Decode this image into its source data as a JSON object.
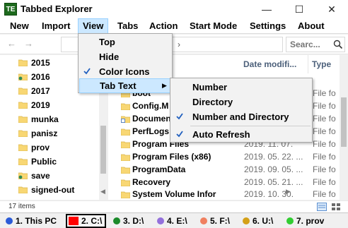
{
  "window": {
    "logo_text": "TE",
    "title": "Tabbed Explorer",
    "minimize_glyph": "—",
    "maximize_glyph": "☐",
    "close_glyph": "✕"
  },
  "menubar": {
    "items": [
      "New",
      "Import",
      "View",
      "Tabs",
      "Action",
      "Start Mode",
      "Settings",
      "About"
    ],
    "active": "View"
  },
  "addressbar": {
    "back_glyph": "←",
    "forward_glyph": "→",
    "path_visible": ":)",
    "chevron": "›",
    "search_placeholder": "Searc..."
  },
  "nav_tree": {
    "items": [
      {
        "label": "2015",
        "icon": "folder-icon"
      },
      {
        "label": "2016",
        "icon": "folder-icon"
      },
      {
        "label": "2017",
        "icon": "folder-icon"
      },
      {
        "label": "2019",
        "icon": "folder-icon"
      },
      {
        "label": "munka",
        "icon": "folder-icon"
      },
      {
        "label": "panisz",
        "icon": "folder-icon"
      },
      {
        "label": "prov",
        "icon": "folder-icon"
      },
      {
        "label": "Public",
        "icon": "folder-icon"
      },
      {
        "label": "save",
        "icon": "folder-icon"
      },
      {
        "label": "signed-out",
        "icon": "folder-icon"
      }
    ]
  },
  "file_list": {
    "columns": {
      "date": "Date modifi...",
      "type": "Type"
    },
    "rows": [
      {
        "name": "boot",
        "date": "",
        "type": "File fo"
      },
      {
        "name": "Config.M",
        "date": "",
        "type": "File fo"
      },
      {
        "name": "Documen",
        "date": "",
        "type": "File fo"
      },
      {
        "name": "PerfLogs",
        "date": "",
        "type": "File fo"
      },
      {
        "name": "Program Files",
        "date": "2019. 11. 07.",
        "type": "File fo"
      },
      {
        "name": "Program Files (x86)",
        "date": "2019. 05. 22. ...",
        "type": "File fo"
      },
      {
        "name": "ProgramData",
        "date": "2019. 09. 05. ...",
        "type": "File fo"
      },
      {
        "name": "Recovery",
        "date": "2019. 05. 21. ...",
        "type": "File fo"
      },
      {
        "name": "System Volume Infor",
        "date": "2019. 10. 30.",
        "type": "File fo"
      }
    ]
  },
  "status": {
    "item_count": "17 items"
  },
  "tabs": [
    {
      "label": "1. This PC",
      "color": "#2b5bd7",
      "shape": "dot",
      "selected": false
    },
    {
      "label": "2. C:\\",
      "color": "#ff0000",
      "shape": "square",
      "selected": true
    },
    {
      "label": "3. D:\\",
      "color": "#1a8a2a",
      "shape": "dot",
      "selected": false
    },
    {
      "label": "4. E:\\",
      "color": "#9370db",
      "shape": "dot",
      "selected": false
    },
    {
      "label": "5. F:\\",
      "color": "#f08060",
      "shape": "dot",
      "selected": false
    },
    {
      "label": "6. U:\\",
      "color": "#d4a017",
      "shape": "dot",
      "selected": false
    },
    {
      "label": "7. prov",
      "color": "#32cd32",
      "shape": "dot",
      "selected": false
    }
  ],
  "view_menu": {
    "items": [
      {
        "label": "Top",
        "checked": false
      },
      {
        "label": "Hide",
        "checked": false
      },
      {
        "label": "Color Icons",
        "checked": true
      },
      {
        "label": "Tab Text",
        "checked": false,
        "submenu": true
      }
    ]
  },
  "tab_text_submenu": {
    "items": [
      {
        "label": "Number",
        "checked": false
      },
      {
        "label": "Directory",
        "checked": false
      },
      {
        "label": "Number and Directory",
        "checked": true
      },
      {
        "label": "Auto Refresh",
        "checked": true
      }
    ]
  },
  "colors": {
    "menu_highlight": "#cce8ff",
    "menu_highlight_border": "#99d1ff",
    "folder_yellow": "#f8d774",
    "check_blue": "#1f5fbf"
  }
}
